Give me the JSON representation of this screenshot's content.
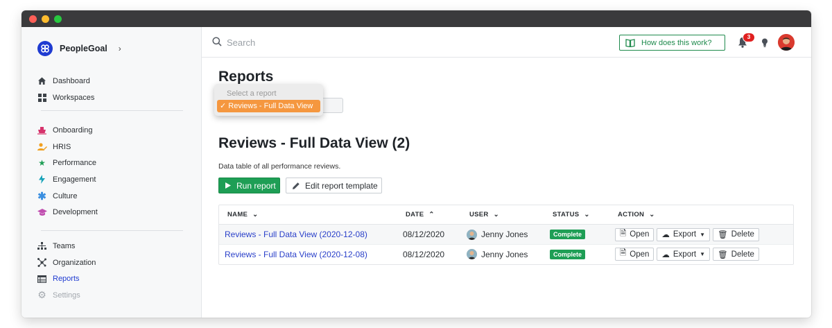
{
  "window": {
    "controls": [
      "close",
      "minimize",
      "maximize"
    ]
  },
  "sidebar": {
    "brand": "PeopleGoal",
    "groups": [
      [
        {
          "label": "Dashboard",
          "icon": "home-icon"
        },
        {
          "label": "Workspaces",
          "icon": "grid-icon"
        }
      ],
      [
        {
          "label": "Onboarding",
          "icon": "ship-icon"
        },
        {
          "label": "HRIS",
          "icon": "user-edit-icon"
        },
        {
          "label": "Performance",
          "icon": "star-icon"
        },
        {
          "label": "Engagement",
          "icon": "bolt-icon"
        },
        {
          "label": "Culture",
          "icon": "asterisk-icon"
        },
        {
          "label": "Development",
          "icon": "graduation-cap-icon"
        }
      ],
      [
        {
          "label": "Teams",
          "icon": "sitemap-icon"
        },
        {
          "label": "Organization",
          "icon": "network-icon"
        },
        {
          "label": "Reports",
          "icon": "table-icon",
          "active": true
        },
        {
          "label": "Settings",
          "icon": "gear-icon",
          "disabled": true
        }
      ]
    ]
  },
  "topbar": {
    "search_placeholder": "Search",
    "help_label": "How does this work?",
    "notification_count": "3"
  },
  "page": {
    "title": "Reports",
    "select": {
      "placeholder": "Select a report",
      "selected": "✓ Reviews - Full Data View"
    },
    "report_title": "Reviews - Full Data View (2)",
    "report_desc": "Data table of all performance reviews.",
    "run_label": "Run report",
    "edit_label": "Edit report template"
  },
  "table": {
    "headers": [
      "NAME",
      "DATE",
      "USER",
      "STATUS",
      "ACTION"
    ],
    "rows": [
      {
        "name": "Reviews - Full Data View (2020-12-08)",
        "date": "08/12/2020",
        "user": "Jenny Jones",
        "status": "Complete"
      },
      {
        "name": "Reviews - Full Data View (2020-12-08)",
        "date": "08/12/2020",
        "user": "Jenny Jones",
        "status": "Complete"
      }
    ],
    "actions": {
      "open": "Open",
      "export": "Export",
      "delete": "Delete"
    }
  },
  "colors": {
    "brand": "#1f3bd1",
    "accent_green": "#1e9e55",
    "link": "#2a40c9",
    "dropdown_highlight": "#f5973f",
    "badge_red": "#e02020"
  }
}
